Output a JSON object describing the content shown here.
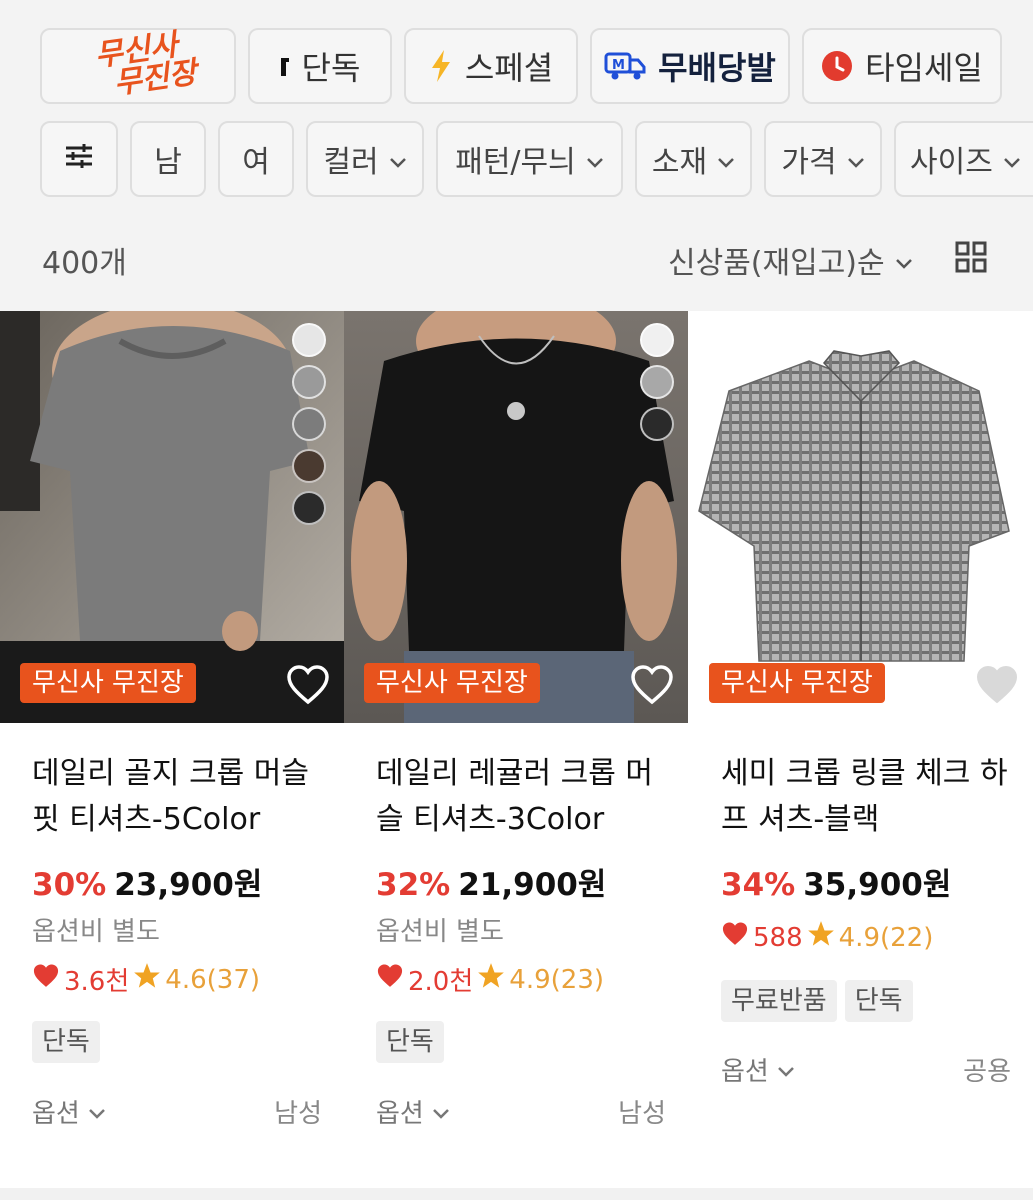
{
  "shortcuts": {
    "logo_line1": "무신사",
    "logo_line2": "무진장",
    "exclusive": "단독",
    "special": "스페셜",
    "free_shipping": "무배당발",
    "time_sale": "타임세일"
  },
  "filters": {
    "male": "남",
    "female": "여",
    "color": "컬러",
    "pattern": "패턴/무늬",
    "material": "소재",
    "price": "가격",
    "size": "사이즈"
  },
  "summary": {
    "count": "400개",
    "sort": "신상품(재입고)순"
  },
  "colors": {
    "accent": "#e8531d",
    "discount": "#e33c33",
    "rating": "#e8a13a"
  },
  "products": [
    {
      "badge": "무신사 무진장",
      "name": "데일리 골지 크롭 머슬 핏 티셔츠-5Color",
      "discount": "30%",
      "price": "23,900원",
      "option_fee": "옵션비 별도",
      "likes": "3.6천",
      "rating": "4.6(37)",
      "tags": [
        "단독"
      ],
      "option": "옵션",
      "gender": "남성",
      "swatches": [
        "#e6e6e6",
        "#9a9a9a",
        "#7c7c7c",
        "#4a3a30",
        "#2b2b2b"
      ]
    },
    {
      "badge": "무신사 무진장",
      "name": "데일리 레귤러 크롭 머슬 티셔츠-3Color",
      "discount": "32%",
      "price": "21,900원",
      "option_fee": "옵션비 별도",
      "likes": "2.0천",
      "rating": "4.9(23)",
      "tags": [
        "단독"
      ],
      "option": "옵션",
      "gender": "남성",
      "swatches": [
        "#f0f0f0",
        "#a8a8a8",
        "#2a2a2a"
      ]
    },
    {
      "badge": "무신사 무진장",
      "name": "세미 크롭 링클 체크 하프 셔츠-블랙",
      "discount": "34%",
      "price": "35,900원",
      "likes": "588",
      "rating": "4.9(22)",
      "tags": [
        "무료반품",
        "단독"
      ],
      "option": "옵션",
      "gender": "공용"
    }
  ]
}
